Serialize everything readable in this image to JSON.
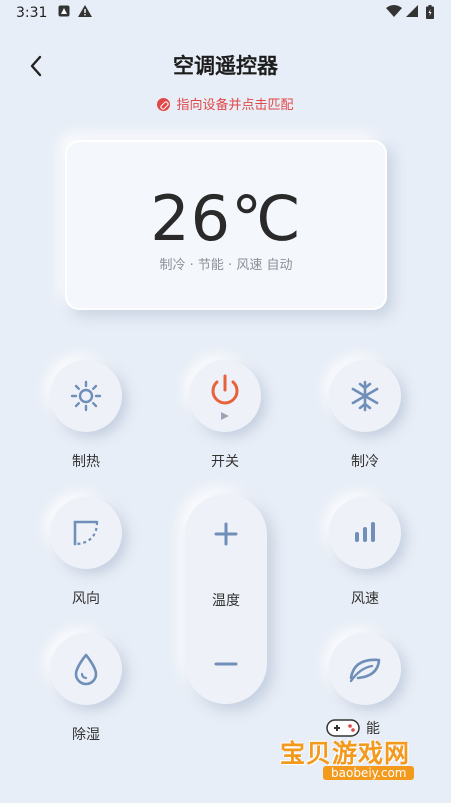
{
  "status": {
    "time": "3:31"
  },
  "header": {
    "title": "空调遥控器",
    "back_label": ""
  },
  "hint": {
    "text": "指向设备并点击匹配"
  },
  "display": {
    "temperature": "26℃",
    "mode_line": "制冷 · 节能 · 风速 自动"
  },
  "buttons": {
    "heat": "制热",
    "power": "开关",
    "cool": "制冷",
    "wind_direction": "风向",
    "temperature": "温度",
    "fan_speed": "风速",
    "dehumidify": "除湿",
    "eco": "能"
  },
  "colors": {
    "accent_red": "#e04848",
    "power_orange": "#e8613a",
    "icon_blue": "#6f8fb8",
    "background": "#e8eef7"
  },
  "watermark": {
    "text": "宝贝游戏网",
    "url": "baobeiy.com"
  }
}
